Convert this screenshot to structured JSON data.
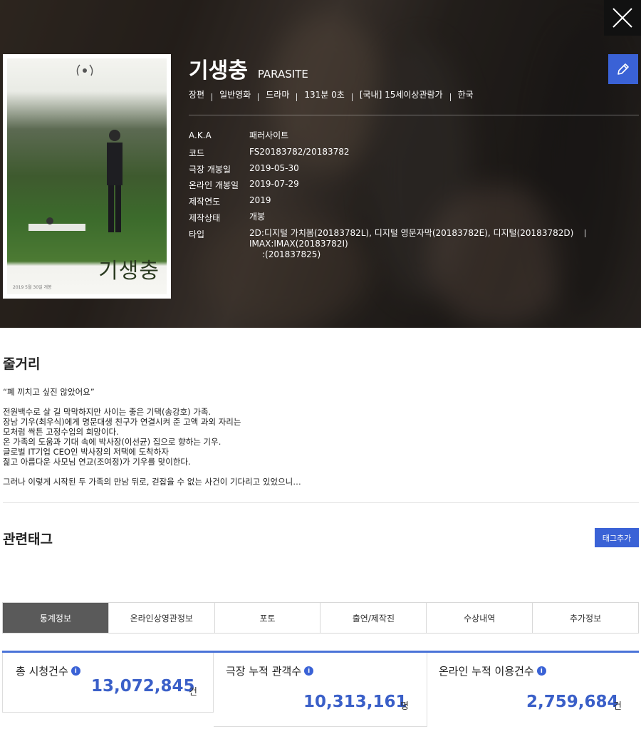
{
  "movie": {
    "title_ko": "기생충",
    "title_en": "PARASITE",
    "meta": [
      "장편",
      "일반영화",
      "드라마",
      "131분 0초",
      "[국내] 15세이상관람가",
      "한국"
    ],
    "info": {
      "aka_label": "A.K.A",
      "aka": "패러사이트",
      "code_label": "코드",
      "code": "FS20183782/20183782",
      "release_label": "극장 개봉일",
      "release": "2019-05-30",
      "online_label": "온라인 개봉일",
      "online": "2019-07-29",
      "year_label": "제작연도",
      "year": "2019",
      "status_label": "제작상태",
      "status": "개봉",
      "type_label": "타입",
      "type_line1": "2D:디지털 가치봄(20183782L), 디지털 영문자막(20183782E), 디지털(20183782D)",
      "type_imax": "IMAX:IMAX(20183782I)",
      "type_line2": ":(201837825)"
    },
    "poster_title": "기생충",
    "poster_footer": "2019 5월 30일 개봉"
  },
  "synopsis": {
    "title": "줄거리",
    "p1": "“폐 끼치고 싶진 않았어요”",
    "p2": [
      "전원백수로 살 길 막막하지만 사이는 좋은 기택(송강호) 가족.",
      "장남 기우(최우식)에게 명문대생 친구가 연결시켜 준 고액 과외 자리는",
      "모처럼 싹튼 고정수입의 희망이다.",
      "온 가족의 도움과 기대 속에 박사장(이선균) 집으로 향하는 기우.",
      "글로벌 IT기업 CEO인 박사장의 저택에 도착하자",
      "젊고 아름다운 사모님 연교(조여정)가 기우를 맞이한다."
    ],
    "p3": "그러나 이렇게 시작된 두 가족의 만남 뒤로, 걷잡을 수 없는 사건이 기다리고 있었으니…"
  },
  "tags": {
    "title": "관련태그",
    "add_label": "태그추가"
  },
  "tabs": [
    "통계정보",
    "온라인상영관정보",
    "포토",
    "출연/제작진",
    "수상내역",
    "추가정보"
  ],
  "stats": [
    {
      "label": "총 시청건수",
      "value": "13,072,845",
      "unit": "건"
    },
    {
      "label": "극장 누적 관객수",
      "value": "10,313,161",
      "unit": "명"
    },
    {
      "label": "온라인 누적 이용건수",
      "value": "2,759,684",
      "unit": "건"
    }
  ],
  "colors": {
    "accent": "#3a62d6",
    "stat_number": "#3a5fc8",
    "active_tab": "#5a5a5a"
  }
}
